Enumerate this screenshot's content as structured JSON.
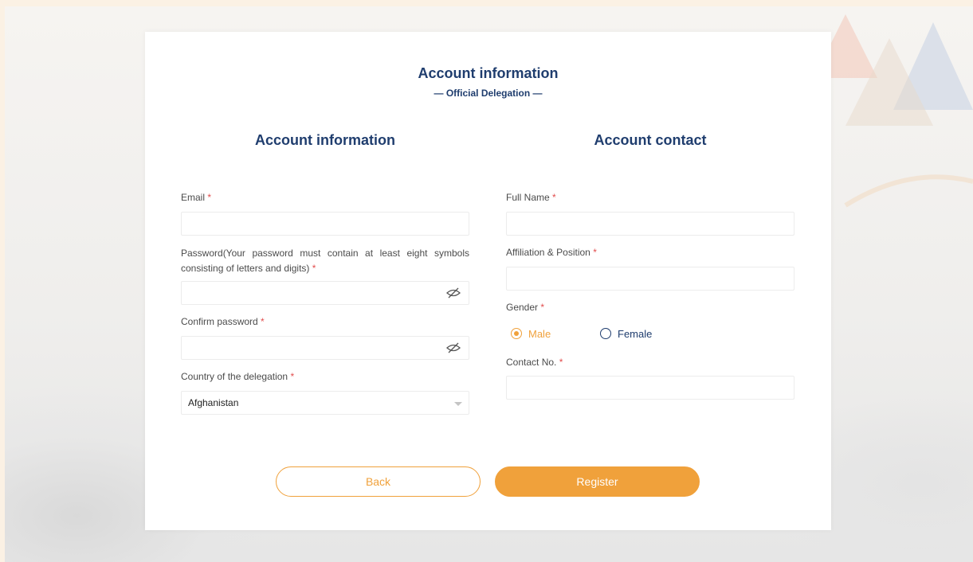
{
  "header": {
    "title": "Account information",
    "subtitle": "— Official Delegation —"
  },
  "left": {
    "heading": "Account information",
    "email": {
      "label": "Email",
      "required": "*",
      "value": ""
    },
    "password": {
      "label": "Password(Your password must contain at least eight symbols consisting of letters and digits)",
      "required": "*",
      "value": "",
      "icon": "eye-hidden-icon"
    },
    "confirm_password": {
      "label": "Confirm password",
      "required": "*",
      "value": "",
      "icon": "eye-hidden-icon"
    },
    "country": {
      "label": "Country of the delegation",
      "required": "*",
      "value": "Afghanistan"
    }
  },
  "right": {
    "heading": "Account contact",
    "full_name": {
      "label": "Full Name",
      "required": "*",
      "value": ""
    },
    "affiliation": {
      "label": "Affiliation & Position",
      "required": "*",
      "value": ""
    },
    "gender": {
      "label": "Gender",
      "required": "*",
      "options": [
        "Male",
        "Female"
      ],
      "selected": "Male"
    },
    "contact_no": {
      "label": "Contact No.",
      "required": "*",
      "value": ""
    }
  },
  "actions": {
    "back_label": "Back",
    "register_label": "Register"
  },
  "colors": {
    "accent": "#f0a13b",
    "navy": "#1f3d6e",
    "required": "#e24d4d"
  }
}
